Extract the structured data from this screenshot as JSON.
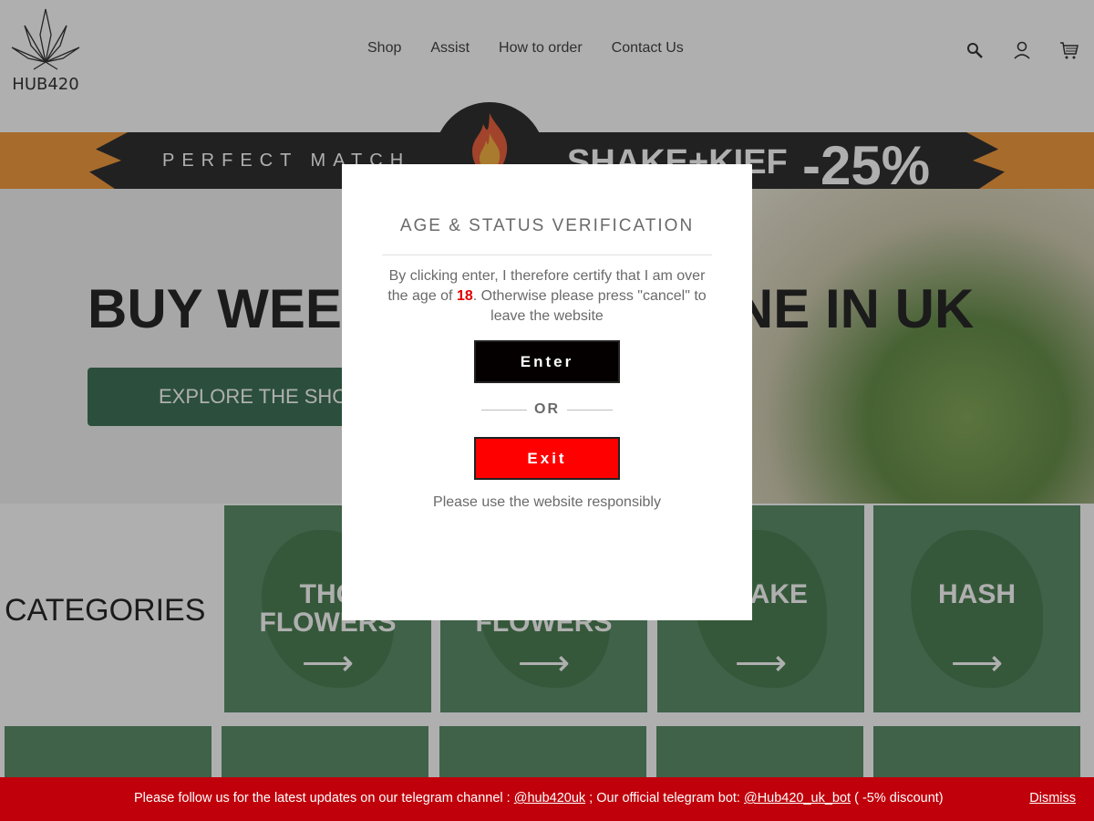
{
  "header": {
    "logo_text": "HUB420",
    "nav": [
      "Shop",
      "Assist",
      "How to order",
      "Contact Us"
    ],
    "icons": [
      "search-icon",
      "account-icon",
      "cart-icon"
    ]
  },
  "promo": {
    "tagline": "PERFECT MATCH",
    "product": "SHAKE+KIEF",
    "discount": "-25%"
  },
  "hero": {
    "title_left": "BUY WEE",
    "title_right": "INE IN UK",
    "button_label": "EXPLORE THE SHO"
  },
  "categories": {
    "label": "CATEGORIES",
    "cards": [
      {
        "name": "THC\nFLOWERS",
        "arrow": "⟶"
      },
      {
        "name": "\nFLOWERS",
        "arrow": "⟶"
      },
      {
        "name": "AKE",
        "arrow": "⟶"
      },
      {
        "name": "HASH",
        "arrow": "⟶"
      }
    ]
  },
  "modal": {
    "title": "AGE & STATUS VERIFICATION",
    "text_before": "By clicking enter, I therefore certify that I am over the age of ",
    "age": "18",
    "text_after": ". Otherwise please press \"cancel\" to leave the website",
    "enter_label": "Enter",
    "or_label": "OR",
    "exit_label": "Exit",
    "footer": "Please use the website responsibly"
  },
  "telegram_bar": {
    "text_1": "Please follow us for the latest updates on our telegram channel : ",
    "channel": "@hub420uk",
    "text_2": " ; Our official telegram bot: ",
    "bot": "@Hub420_uk_bot",
    "text_3": " ( -5% discount)",
    "dismiss": "Dismiss"
  },
  "colors": {
    "brand_green": "#1d5b3a",
    "exit_red": "#ff0000",
    "bar_red": "#c0000b",
    "flame_orange": "#f18a1e"
  }
}
